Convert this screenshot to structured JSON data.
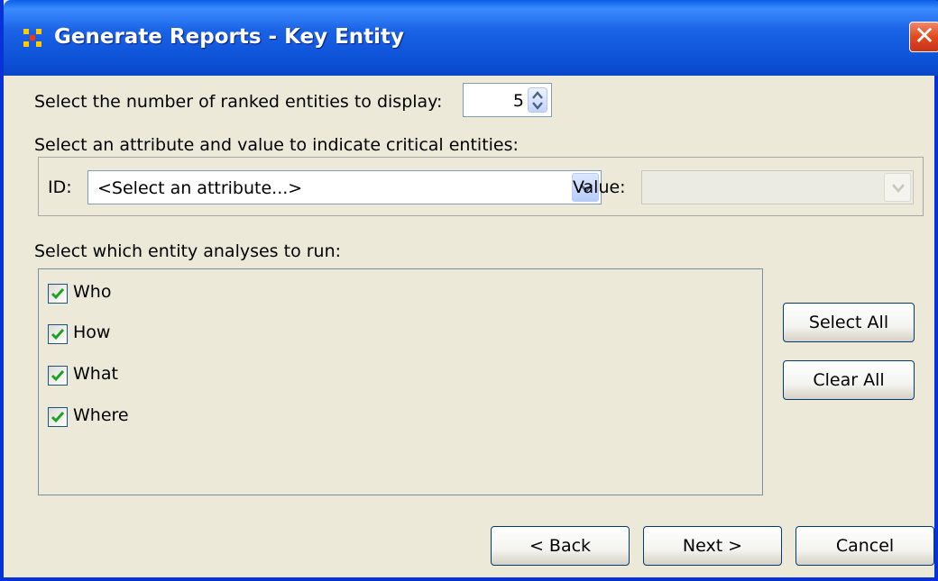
{
  "window": {
    "title": "Generate Reports - Key Entity",
    "app_icon": "ora-network-icon",
    "close_label": "✕"
  },
  "ranked": {
    "label": "Select the number of ranked entities to display:",
    "value": "5"
  },
  "attribute": {
    "section_label": "Select an attribute and value to indicate critical entities:",
    "id_label": "ID:",
    "id_value": "<Select an attribute...>",
    "value_label": "Value:",
    "value_value": ""
  },
  "analyses": {
    "section_label": "Select which entity analyses to run:",
    "items": [
      {
        "label": "Who",
        "checked": true
      },
      {
        "label": "How",
        "checked": true
      },
      {
        "label": "What",
        "checked": true
      },
      {
        "label": "Where",
        "checked": true
      }
    ],
    "select_all_label": "Select All",
    "clear_all_label": "Clear All"
  },
  "footer": {
    "back_label": "< Back",
    "next_label": "Next >",
    "cancel_label": "Cancel"
  },
  "colors": {
    "titlebar": "#0a4fd4",
    "dialog_bg": "#ece9d8",
    "checkmark": "#21a121",
    "close": "#e04a1e"
  }
}
